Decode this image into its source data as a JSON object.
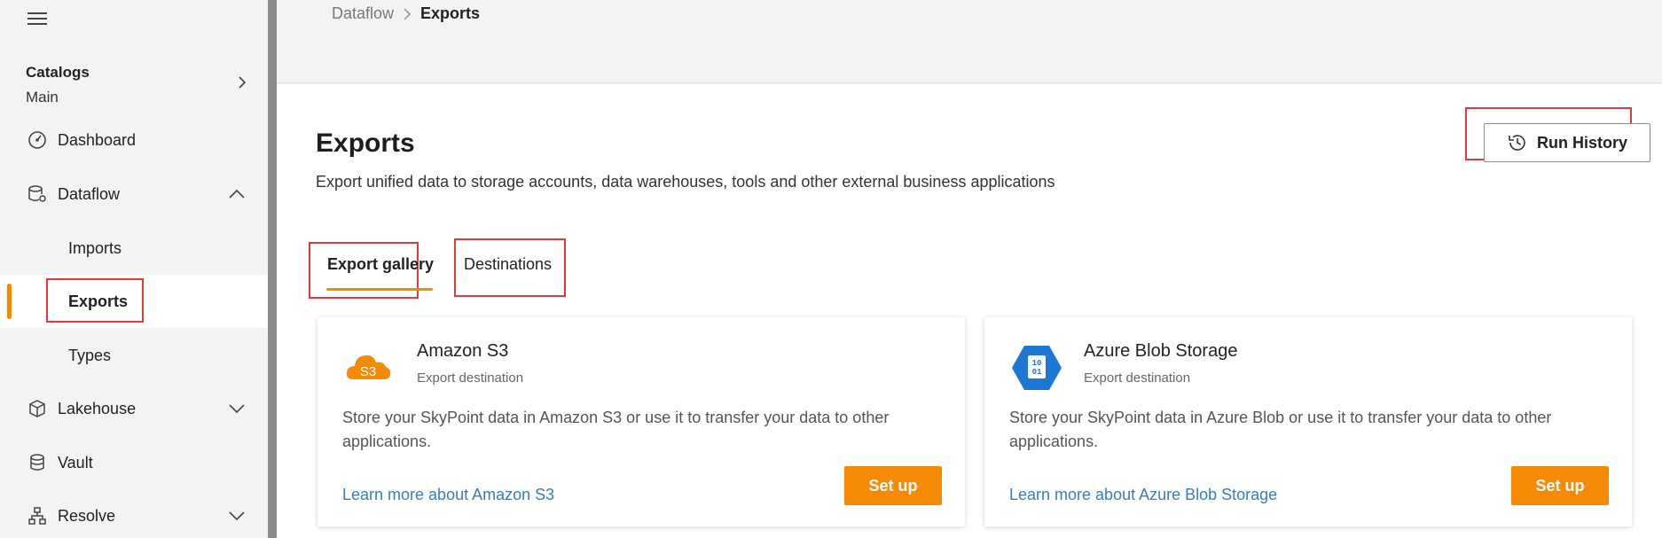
{
  "sidebar": {
    "menu_icon": "hamburger-icon",
    "catalog": {
      "title": "Catalogs",
      "subtitle": "Main"
    },
    "items": [
      {
        "label": "Dashboard",
        "icon": "gauge-icon"
      },
      {
        "label": "Dataflow",
        "icon": "database-gear-icon"
      },
      {
        "label": "Imports"
      },
      {
        "label": "Exports"
      },
      {
        "label": "Types"
      },
      {
        "label": "Lakehouse",
        "icon": "cube-icon"
      },
      {
        "label": "Vault",
        "icon": "database-icon"
      },
      {
        "label": "Resolve",
        "icon": "hierarchy-icon"
      }
    ],
    "active_color": "#f58a07"
  },
  "breadcrumb": {
    "root": "Dataflow",
    "current": "Exports"
  },
  "page": {
    "title": "Exports",
    "description": "Export unified data to storage accounts, data warehouses, tools and other external business applications",
    "run_history": "Run History"
  },
  "tabs": [
    {
      "label": "Export gallery"
    },
    {
      "label": "Destinations"
    }
  ],
  "cards": [
    {
      "title": "Amazon S3",
      "subtitle": "Export destination",
      "logo_text": "S3",
      "description": "Store your SkyPoint data in Amazon S3 or use it to transfer your data to other applications.",
      "link": "Learn more about Amazon S3",
      "button": "Set up"
    },
    {
      "title": "Azure Blob Storage",
      "subtitle": "Export destination",
      "logo_text": "10 01",
      "description": "Store your SkyPoint data in Azure Blob or use it to transfer your data to other applications.",
      "link": "Learn more about Azure Blob Storage",
      "button": "Set up"
    }
  ],
  "colors": {
    "accent": "#f58a07",
    "link": "#3a7cbf",
    "highlight": "#e23a3a",
    "azure": "#1f77d4"
  }
}
